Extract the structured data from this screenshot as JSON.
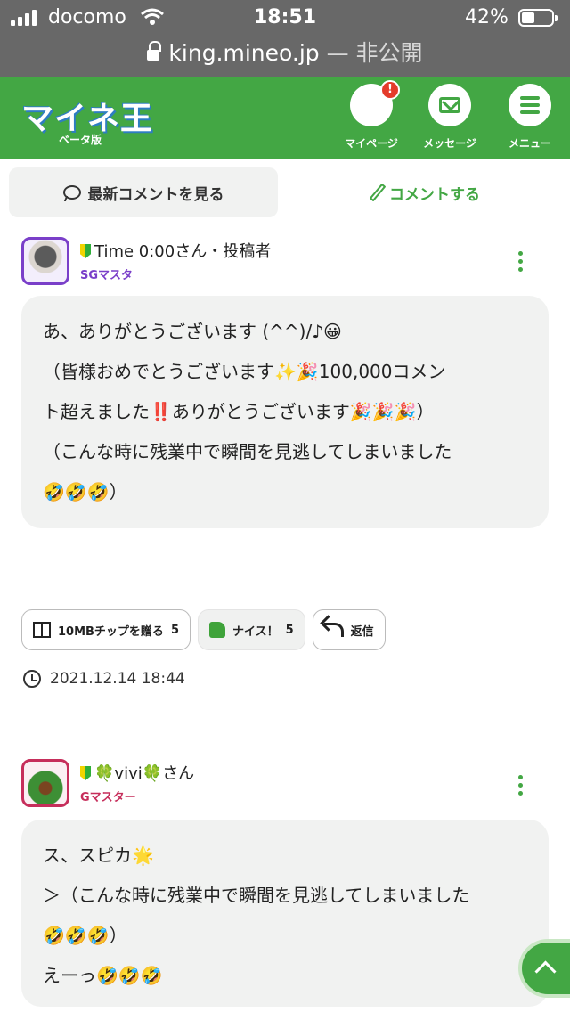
{
  "status_bar": {
    "carrier": "docomo",
    "time": "18:51",
    "battery_percent": "42%",
    "battery_level": 0.42
  },
  "url_bar": {
    "host": "king.mineo.jp",
    "suffix": " — 非公開"
  },
  "header": {
    "logo_text": "マイネ王",
    "beta_label": "ベータ版",
    "nav": [
      {
        "label": "マイページ",
        "icon": "avatar-clover",
        "badge": "!"
      },
      {
        "label": "メッセージ",
        "icon": "mail-icon"
      },
      {
        "label": "メニュー",
        "icon": "menu-icon"
      }
    ],
    "accent_color": "#43a744"
  },
  "tabs": {
    "latest_label": "最新コメントを見る",
    "comment_label": "コメントする"
  },
  "posts": [
    {
      "user": "Time 0:00さん・投稿者",
      "rank": "SGマスタ",
      "lines": [
        "あ、ありがとうございます (^^)/♪😀",
        "",
        "（皆様おめでとうございます✨🎉100,000コメン",
        "ト超えました‼️ありがとうございます🎉🎉🎉）",
        "",
        "（こんな時に残業中で瞬間を見逃してしまいました",
        "🤣🤣🤣）"
      ]
    },
    {
      "user": "🍀vivi🍀さん",
      "rank": "Gマスター",
      "lines": [
        "ス、スピカ🌟",
        "＞（こんな時に残業中で瞬間を見逃してしまいました",
        "🤣🤣🤣）",
        "えーっ🤣🤣🤣"
      ]
    }
  ],
  "actions": {
    "tip_label": "10MBチップを贈る",
    "tip_count": "5",
    "nice_label": "ナイス！",
    "nice_count": "5",
    "reply_label": "返信"
  },
  "post_date": "2021.12.14 18:44"
}
